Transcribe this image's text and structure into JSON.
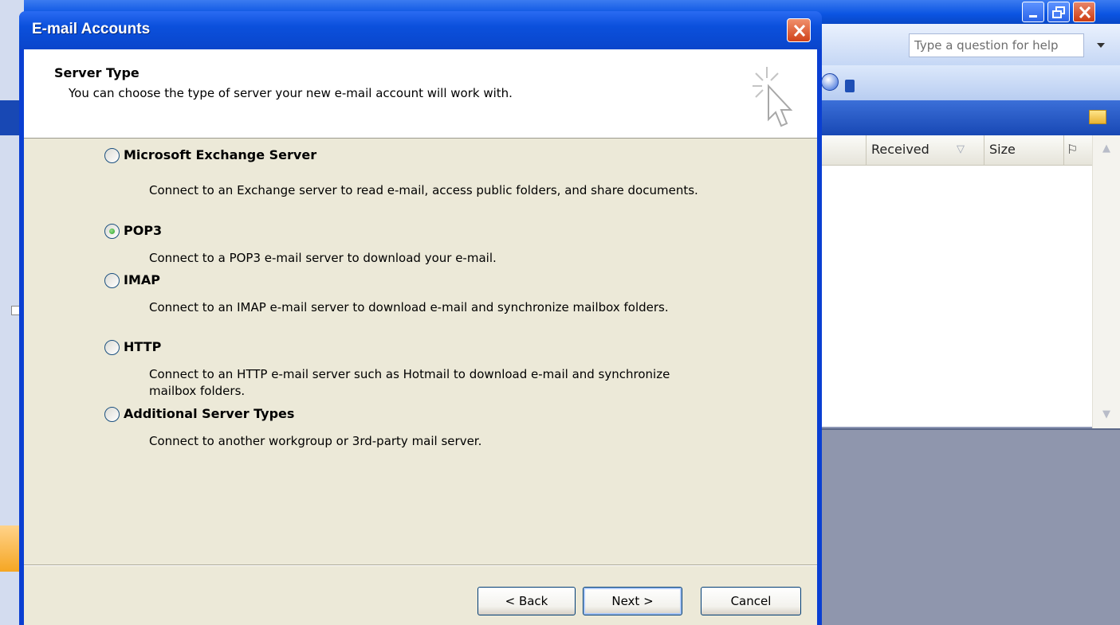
{
  "background_window": {
    "help_box_placeholder": "Type a question for help",
    "columns": {
      "received": "Received",
      "size": "Size"
    }
  },
  "dialog": {
    "title": "E-mail Accounts",
    "header": {
      "title": "Server Type",
      "description": "You can choose the type of server your new e-mail account will work with."
    },
    "options": [
      {
        "label": "Microsoft Exchange Server",
        "description": "Connect to an Exchange server to read e-mail, access public folders, and share documents.",
        "selected": false
      },
      {
        "label": "POP3",
        "description": "Connect to a POP3 e-mail server to download your e-mail.",
        "selected": true
      },
      {
        "label": "IMAP",
        "description": "Connect to an IMAP e-mail server to download e-mail and synchronize mailbox folders.",
        "selected": false
      },
      {
        "label": "HTTP",
        "description": "Connect to an HTTP e-mail server such as Hotmail to download e-mail and synchronize mailbox folders.",
        "selected": false
      },
      {
        "label": "Additional Server Types",
        "description": "Connect to another workgroup or 3rd-party mail server.",
        "selected": false
      }
    ],
    "buttons": {
      "back": "< Back",
      "next": "Next >",
      "cancel": "Cancel"
    }
  },
  "colors": {
    "xp_title_blue": "#0a50dc",
    "dialog_body": "#ece9d8",
    "radio_checked": "#21a121",
    "close_red": "#d0421a"
  }
}
